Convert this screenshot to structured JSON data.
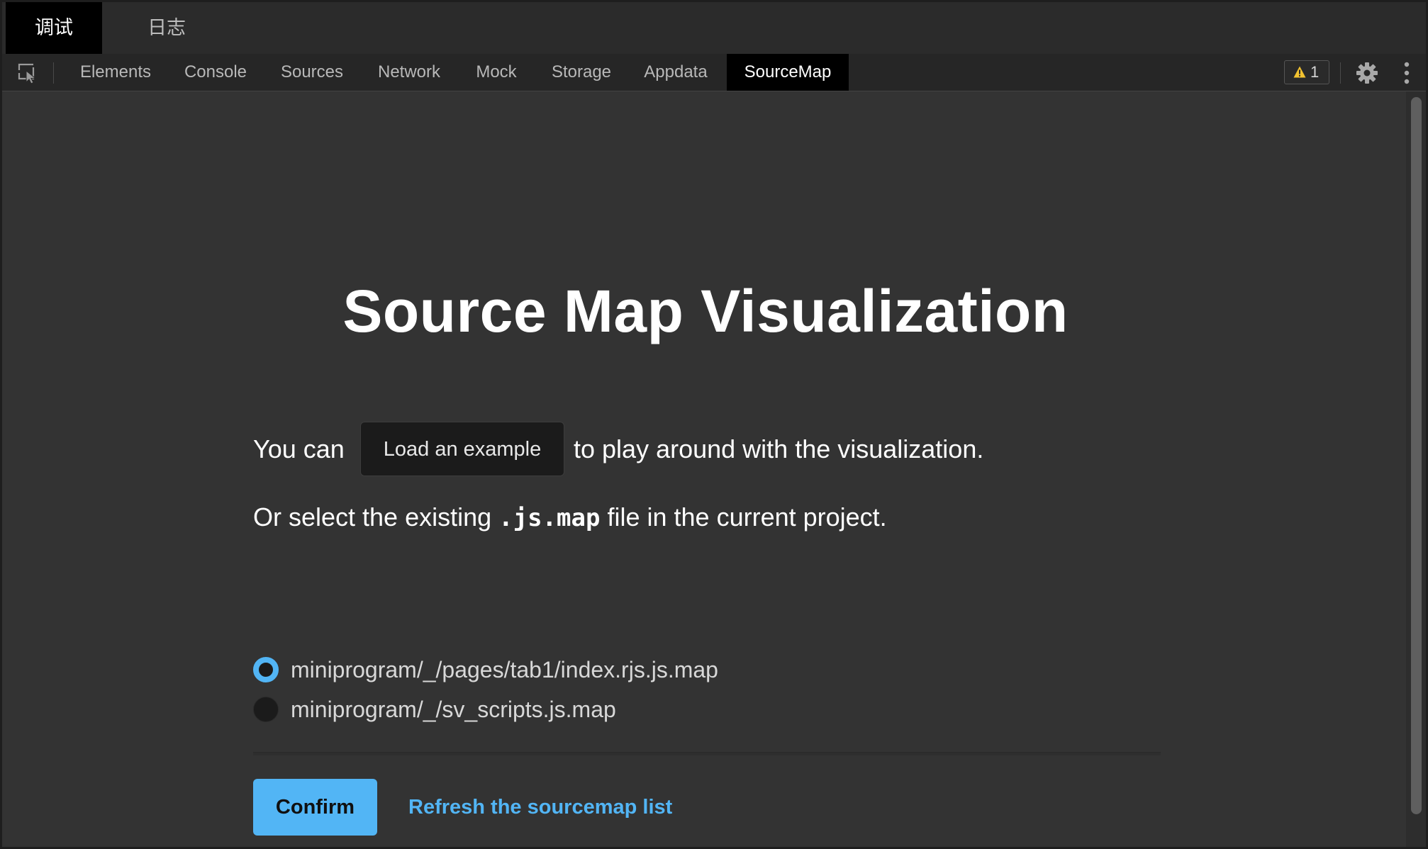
{
  "top_tabs": [
    {
      "label": "调试",
      "active": true
    },
    {
      "label": "日志",
      "active": false
    }
  ],
  "toolbar": {
    "tabs": [
      {
        "label": "Elements",
        "active": false
      },
      {
        "label": "Console",
        "active": false
      },
      {
        "label": "Sources",
        "active": false
      },
      {
        "label": "Network",
        "active": false
      },
      {
        "label": "Mock",
        "active": false
      },
      {
        "label": "Storage",
        "active": false
      },
      {
        "label": "Appdata",
        "active": false
      },
      {
        "label": "SourceMap",
        "active": true
      }
    ],
    "warning_count": "1",
    "icons": [
      "inspect-element-icon",
      "warning-icon",
      "gear-icon",
      "more-vertical-icon"
    ]
  },
  "main": {
    "title": "Source Map Visualization",
    "intro_prefix": "You can",
    "load_example_label": "Load an example",
    "intro_suffix": "to play around with the visualization.",
    "select_prefix": "Or select the existing",
    "select_code": ".js.map",
    "select_suffix": "file in the current project.",
    "files": [
      {
        "label": "miniprogram/_/pages/tab1/index.rjs.js.map",
        "selected": true
      },
      {
        "label": "miniprogram/_/sv_scripts.js.map",
        "selected": false
      }
    ],
    "confirm_label": "Confirm",
    "refresh_label": "Refresh the sourcemap list"
  },
  "colors": {
    "accent": "#52b5f5",
    "background": "#333333",
    "toolbar": "#262626",
    "active_tab": "#000000"
  }
}
